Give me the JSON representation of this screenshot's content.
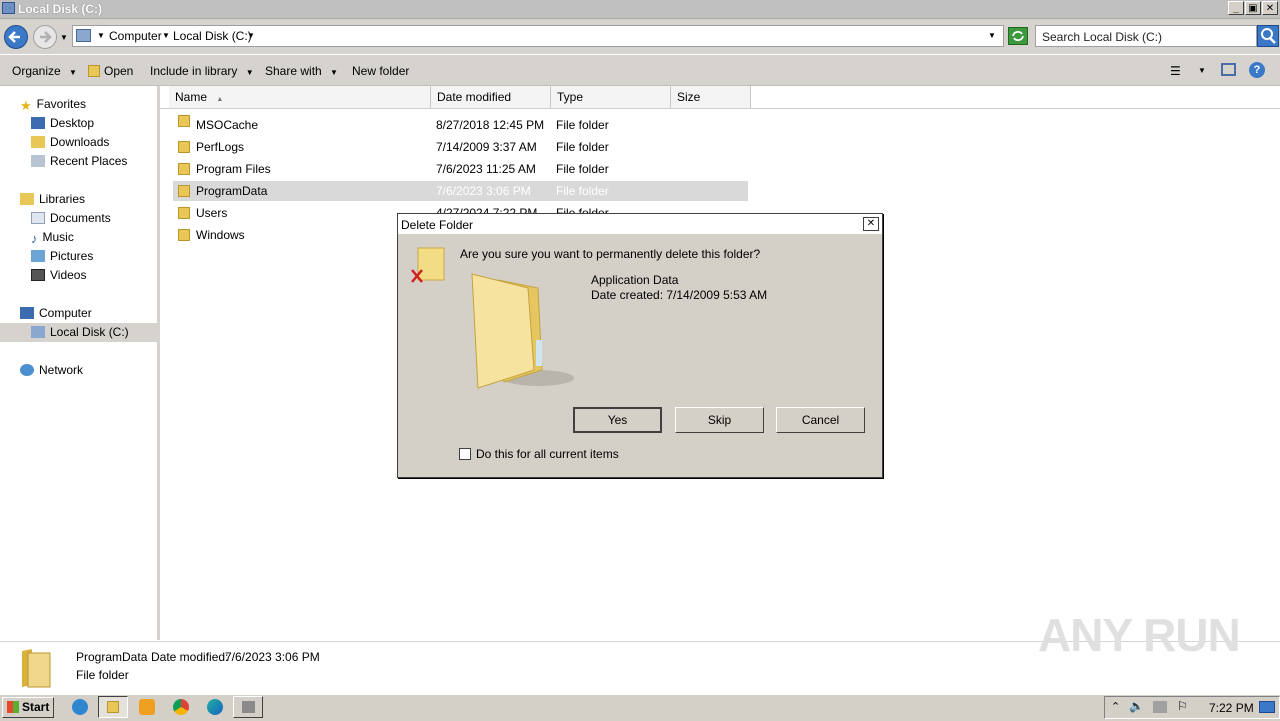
{
  "window": {
    "title": "Local Disk (C:)",
    "minimize": "_",
    "maximize": "▣",
    "close": "✕"
  },
  "address": {
    "breadcrumb": [
      "Computer",
      "Local Disk (C:)"
    ],
    "search_placeholder": "Search Local Disk (C:)"
  },
  "toolbar": {
    "organize": "Organize",
    "open": "Open",
    "include_in_library": "Include in library",
    "share_with": "Share with",
    "new_folder": "New folder"
  },
  "nav": {
    "favorites": "Favorites",
    "favorites_items": [
      "Desktop",
      "Downloads",
      "Recent Places"
    ],
    "libraries": "Libraries",
    "libraries_items": [
      "Documents",
      "Music",
      "Pictures",
      "Videos"
    ],
    "computer": "Computer",
    "computer_items": [
      "Local Disk (C:)"
    ],
    "network": "Network"
  },
  "columns": [
    "Name",
    "Date modified",
    "Type",
    "Size"
  ],
  "files": [
    {
      "name": "MSOCache",
      "date": "8/27/2018 12:45 PM",
      "type": "File folder"
    },
    {
      "name": "PerfLogs",
      "date": "7/14/2009 3:37 AM",
      "type": "File folder"
    },
    {
      "name": "Program Files",
      "date": "7/6/2023 11:25 AM",
      "type": "File folder"
    },
    {
      "name": "ProgramData",
      "date": "7/6/2023 3:06 PM",
      "type": "File folder"
    },
    {
      "name": "Users",
      "date": "4/27/2024 7:22 PM",
      "type": "File folder"
    },
    {
      "name": "Windows",
      "date": "",
      "type": ""
    }
  ],
  "details": {
    "name": "ProgramData",
    "date_label": "Date modified:",
    "date": "7/6/2023 3:06 PM",
    "type": "File folder"
  },
  "dialog": {
    "title": "Delete Folder",
    "close": "✕",
    "question": "Are you sure you want to permanently delete this folder?",
    "item_name": "Application Data",
    "date_created": "Date created: 7/14/2009 5:53 AM",
    "yes": "Yes",
    "skip": "Skip",
    "cancel": "Cancel",
    "checkbox_label": "Do this for all current items"
  },
  "taskbar": {
    "start": "Start",
    "clock": "7:22 PM"
  },
  "watermark": "ANY RUN"
}
